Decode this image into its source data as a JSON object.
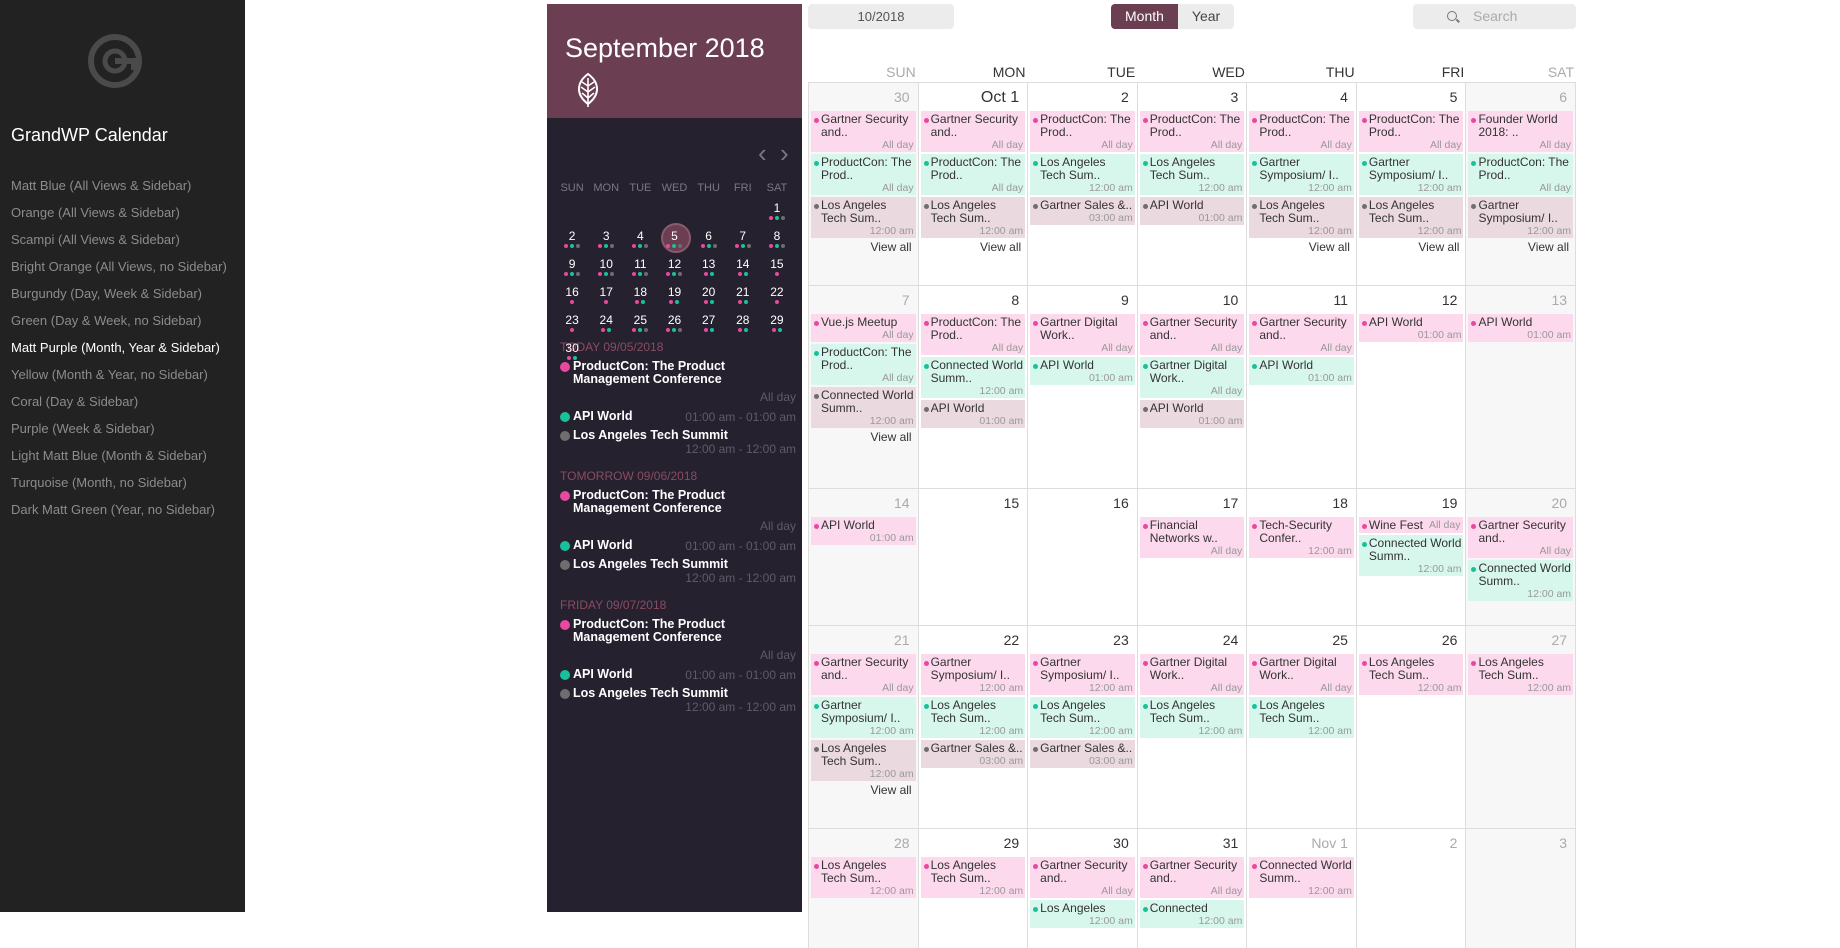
{
  "nav": {
    "app_title": "GrandWP Calendar",
    "active_index": 6,
    "items": [
      "Matt Blue (All Views & Sidebar)",
      "Orange (All Views & Sidebar)",
      "Scampi (All Views & Sidebar)",
      "Bright Orange (All Views, no Sidebar)",
      "Burgundy (Day, Week & Sidebar)",
      "Green (Day & Week, no Sidebar)",
      "Matt Purple (Month, Year & Sidebar)",
      "Yellow (Month & Year, no Sidebar)",
      "Coral (Day & Sidebar)",
      "Purple (Week & Sidebar)",
      "Light Matt Blue (Month & Sidebar)",
      "Turquoise (Month, no Sidebar)",
      "Dark Matt Green (Year, no Sidebar)"
    ]
  },
  "colors": {
    "pink": "#e8489f",
    "green": "#17c29a",
    "gray": "#6e6e6e",
    "accent": "#6b3e52"
  },
  "sidebar": {
    "month_title": "September 2018",
    "prev": "‹",
    "next": "›",
    "weekdays": [
      "SUN",
      "MON",
      "TUE",
      "WED",
      "THU",
      "FRI",
      "SAT"
    ],
    "weeks": [
      [
        null,
        null,
        null,
        null,
        null,
        null,
        {
          "d": "1",
          "e": [
            "pink",
            "green",
            "gray"
          ]
        }
      ],
      [
        {
          "d": "2",
          "e": [
            "pink",
            "green",
            "gray"
          ]
        },
        {
          "d": "3",
          "e": [
            "pink",
            "green",
            "gray"
          ]
        },
        {
          "d": "4",
          "e": [
            "pink",
            "green",
            "gray"
          ]
        },
        {
          "d": "5",
          "e": [
            "pink",
            "green",
            "gray"
          ],
          "today": true
        },
        {
          "d": "6",
          "e": [
            "pink",
            "green",
            "gray"
          ]
        },
        {
          "d": "7",
          "e": [
            "pink",
            "green",
            "gray"
          ]
        },
        {
          "d": "8",
          "e": [
            "pink",
            "green",
            "gray"
          ]
        }
      ],
      [
        {
          "d": "9",
          "e": [
            "pink",
            "green",
            "gray"
          ]
        },
        {
          "d": "10",
          "e": [
            "pink",
            "green",
            "gray"
          ]
        },
        {
          "d": "11",
          "e": [
            "pink",
            "green",
            "gray"
          ]
        },
        {
          "d": "12",
          "e": [
            "pink",
            "green",
            "gray"
          ]
        },
        {
          "d": "13",
          "e": [
            "pink",
            "green"
          ]
        },
        {
          "d": "14",
          "e": [
            "pink",
            "green"
          ]
        },
        {
          "d": "15",
          "e": [
            "pink"
          ]
        }
      ],
      [
        {
          "d": "16",
          "e": [
            "pink"
          ]
        },
        {
          "d": "17",
          "e": [
            "pink"
          ]
        },
        {
          "d": "18",
          "e": [
            "pink",
            "green"
          ]
        },
        {
          "d": "19",
          "e": [
            "pink",
            "green"
          ]
        },
        {
          "d": "20",
          "e": [
            "pink",
            "green"
          ]
        },
        {
          "d": "21",
          "e": [
            "pink",
            "green"
          ]
        },
        {
          "d": "22",
          "e": [
            "pink"
          ]
        }
      ],
      [
        {
          "d": "23",
          "e": [
            "pink"
          ]
        },
        {
          "d": "24",
          "e": [
            "pink",
            "green"
          ]
        },
        {
          "d": "25",
          "e": [
            "pink",
            "green",
            "gray"
          ]
        },
        {
          "d": "26",
          "e": [
            "pink",
            "green",
            "gray"
          ]
        },
        {
          "d": "27",
          "e": [
            "pink",
            "green"
          ]
        },
        {
          "d": "28",
          "e": [
            "pink",
            "green"
          ]
        },
        {
          "d": "29",
          "e": [
            "pink",
            "green"
          ]
        }
      ],
      [
        {
          "d": "30",
          "e": [
            "pink",
            "green"
          ]
        },
        null,
        null,
        null,
        null,
        null,
        null
      ]
    ],
    "groups": [
      {
        "title": "TODAY 09/05/2018",
        "events": [
          {
            "name": "ProductCon: The Product Management Conference",
            "time": "All day",
            "color": "pink"
          },
          {
            "name": "API World",
            "time": "01:00 am - 01:00 am",
            "color": "green",
            "inline": true
          },
          {
            "name": "Los Angeles Tech Summit",
            "time": "12:00 am - 12:00 am",
            "color": "gray"
          }
        ]
      },
      {
        "title": "TOMORROW 09/06/2018",
        "events": [
          {
            "name": "ProductCon: The Product Management Conference",
            "time": "All day",
            "color": "pink"
          },
          {
            "name": "API World",
            "time": "01:00 am - 01:00 am",
            "color": "green",
            "inline": true
          },
          {
            "name": "Los Angeles Tech Summit",
            "time": "12:00 am - 12:00 am",
            "color": "gray"
          }
        ]
      },
      {
        "title": "FRIDAY 09/07/2018",
        "events": [
          {
            "name": "ProductCon: The Product Management Conference",
            "time": "All day",
            "color": "pink"
          },
          {
            "name": "API World",
            "time": "01:00 am - 01:00 am",
            "color": "green",
            "inline": true
          },
          {
            "name": "Los Angeles Tech Summit",
            "time": "12:00 am - 12:00 am",
            "color": "gray"
          }
        ]
      }
    ]
  },
  "toolbar": {
    "date_value": "10/2018",
    "views": [
      {
        "label": "Month",
        "active": true
      },
      {
        "label": "Year",
        "active": false
      }
    ],
    "search_placeholder": "Search"
  },
  "calendar": {
    "weekdays": [
      "SUN",
      "MON",
      "TUE",
      "WED",
      "THU",
      "FRI",
      "SAT"
    ],
    "view_all": "View all",
    "weeks": [
      [
        {
          "d": "30",
          "out": true,
          "ev": [
            [
              "pink",
              "Gartner Security and..",
              "All day"
            ],
            [
              "green",
              "ProductCon: The Prod..",
              "All day"
            ],
            [
              "gray",
              "Los Angeles Tech Sum..",
              "12:00 am"
            ]
          ],
          "va": true
        },
        {
          "d": "Oct 1",
          "big": true,
          "ev": [
            [
              "pink",
              "Gartner Security and..",
              "All day"
            ],
            [
              "green",
              "ProductCon: The Prod..",
              "All day"
            ],
            [
              "gray",
              "Los Angeles Tech Sum..",
              "12:00 am"
            ]
          ],
          "va": true
        },
        {
          "d": "2",
          "ev": [
            [
              "pink",
              "ProductCon: The Prod..",
              "All day"
            ],
            [
              "green",
              "Los Angeles Tech Sum..",
              "12:00 am"
            ],
            [
              "gray",
              "Gartner Sales &..",
              "03:00 am"
            ]
          ]
        },
        {
          "d": "3",
          "ev": [
            [
              "pink",
              "ProductCon: The Prod..",
              "All day"
            ],
            [
              "green",
              "Los Angeles Tech Sum..",
              "12:00 am"
            ],
            [
              "gray",
              "API World",
              "01:00 am"
            ]
          ]
        },
        {
          "d": "4",
          "ev": [
            [
              "pink",
              "ProductCon: The Prod..",
              "All day"
            ],
            [
              "green",
              "Gartner Symposium/ I..",
              "12:00 am"
            ],
            [
              "gray",
              "Los Angeles Tech Sum..",
              "12:00 am"
            ]
          ],
          "va": true
        },
        {
          "d": "5",
          "ev": [
            [
              "pink",
              "ProductCon: The Prod..",
              "All day"
            ],
            [
              "green",
              "Gartner Symposium/ I..",
              "12:00 am"
            ],
            [
              "gray",
              "Los Angeles Tech Sum..",
              "12:00 am"
            ]
          ],
          "va": true
        },
        {
          "d": "6",
          "out": true,
          "ev": [
            [
              "pink",
              "Founder World 2018: ..",
              "All day"
            ],
            [
              "green",
              "ProductCon: The Prod..",
              "All day"
            ],
            [
              "gray",
              "Gartner Symposium/ I..",
              "12:00 am"
            ]
          ],
          "va": true
        }
      ],
      [
        {
          "d": "7",
          "out": true,
          "ev": [
            [
              "pink",
              "Vue.js Meetup",
              "All day"
            ],
            [
              "green",
              "ProductCon: The Prod..",
              "All day"
            ],
            [
              "gray",
              "Connected World Summ..",
              "12:00 am"
            ]
          ],
          "va": true
        },
        {
          "d": "8",
          "ev": [
            [
              "pink",
              "ProductCon: The Prod..",
              "All day"
            ],
            [
              "green",
              "Connected World Summ..",
              "12:00 am"
            ],
            [
              "gray",
              "API World",
              "01:00 am"
            ]
          ]
        },
        {
          "d": "9",
          "ev": [
            [
              "pink",
              "Gartner Digital Work..",
              "All day"
            ],
            [
              "green",
              "API World",
              "01:00 am"
            ]
          ]
        },
        {
          "d": "10",
          "ev": [
            [
              "pink",
              "Gartner Security and..",
              "All day"
            ],
            [
              "green",
              "Gartner Digital Work..",
              "All day"
            ],
            [
              "gray",
              "API World",
              "01:00 am"
            ]
          ]
        },
        {
          "d": "11",
          "ev": [
            [
              "pink",
              "Gartner Security and..",
              "All day"
            ],
            [
              "green",
              "API World",
              "01:00 am"
            ]
          ]
        },
        {
          "d": "12",
          "ev": [
            [
              "pink",
              "API World",
              "01:00 am"
            ]
          ]
        },
        {
          "d": "13",
          "out": true,
          "ev": [
            [
              "pink",
              "API World",
              "01:00 am"
            ]
          ]
        }
      ],
      [
        {
          "d": "14",
          "out": true,
          "ev": [
            [
              "pink",
              "API World",
              "01:00 am"
            ]
          ]
        },
        {
          "d": "15",
          "ev": []
        },
        {
          "d": "16",
          "ev": []
        },
        {
          "d": "17",
          "ev": [
            [
              "pink",
              "Financial Networks w..",
              "All day"
            ]
          ]
        },
        {
          "d": "18",
          "ev": [
            [
              "pink",
              "Tech-Security Confer..",
              "12:00 am"
            ]
          ]
        },
        {
          "d": "19",
          "ev": [
            [
              "pink",
              "Wine Fest",
              "All day",
              true
            ],
            [
              "green",
              "Connected World Summ..",
              "12:00 am"
            ]
          ]
        },
        {
          "d": "20",
          "out": true,
          "ev": [
            [
              "pink",
              "Gartner Security and..",
              "All day"
            ],
            [
              "green",
              "Connected World Summ..",
              "12:00 am"
            ]
          ]
        }
      ],
      [
        {
          "d": "21",
          "out": true,
          "ev": [
            [
              "pink",
              "Gartner Security and..",
              "All day"
            ],
            [
              "green",
              "Gartner Symposium/ I..",
              "12:00 am"
            ],
            [
              "gray",
              "Los Angeles Tech Sum..",
              "12:00 am"
            ]
          ],
          "va": true
        },
        {
          "d": "22",
          "ev": [
            [
              "pink",
              "Gartner Symposium/ I..",
              "12:00 am"
            ],
            [
              "green",
              "Los Angeles Tech Sum..",
              "12:00 am"
            ],
            [
              "gray",
              "Gartner Sales &..",
              "03:00 am"
            ]
          ]
        },
        {
          "d": "23",
          "ev": [
            [
              "pink",
              "Gartner Symposium/ I..",
              "12:00 am"
            ],
            [
              "green",
              "Los Angeles Tech Sum..",
              "12:00 am"
            ],
            [
              "gray",
              "Gartner Sales &..",
              "03:00 am"
            ]
          ]
        },
        {
          "d": "24",
          "ev": [
            [
              "pink",
              "Gartner Digital Work..",
              "All day"
            ],
            [
              "green",
              "Los Angeles Tech Sum..",
              "12:00 am"
            ]
          ]
        },
        {
          "d": "25",
          "ev": [
            [
              "pink",
              "Gartner Digital Work..",
              "All day"
            ],
            [
              "green",
              "Los Angeles Tech Sum..",
              "12:00 am"
            ]
          ]
        },
        {
          "d": "26",
          "ev": [
            [
              "pink",
              "Los Angeles Tech Sum..",
              "12:00 am"
            ]
          ]
        },
        {
          "d": "27",
          "out": true,
          "ev": [
            [
              "pink",
              "Los Angeles Tech Sum..",
              "12:00 am"
            ]
          ]
        }
      ],
      [
        {
          "d": "28",
          "out": true,
          "ev": [
            [
              "pink",
              "Los Angeles Tech Sum..",
              "12:00 am"
            ]
          ]
        },
        {
          "d": "29",
          "ev": [
            [
              "pink",
              "Los Angeles Tech Sum..",
              "12:00 am"
            ]
          ]
        },
        {
          "d": "30",
          "ev": [
            [
              "pink",
              "Gartner Security and..",
              "All day"
            ],
            [
              "green",
              "Los Angeles",
              "12:00 am"
            ]
          ]
        },
        {
          "d": "31",
          "ev": [
            [
              "pink",
              "Gartner Security and..",
              "All day"
            ],
            [
              "green",
              "Connected",
              "12:00 am"
            ]
          ]
        },
        {
          "d": "Nov 1",
          "grey": true,
          "ev": [
            [
              "pink",
              "Connected World Summ..",
              "12:00 am"
            ]
          ]
        },
        {
          "d": "2",
          "grey": true,
          "ev": []
        },
        {
          "d": "3",
          "grey": true,
          "out": true,
          "ev": []
        }
      ]
    ]
  }
}
